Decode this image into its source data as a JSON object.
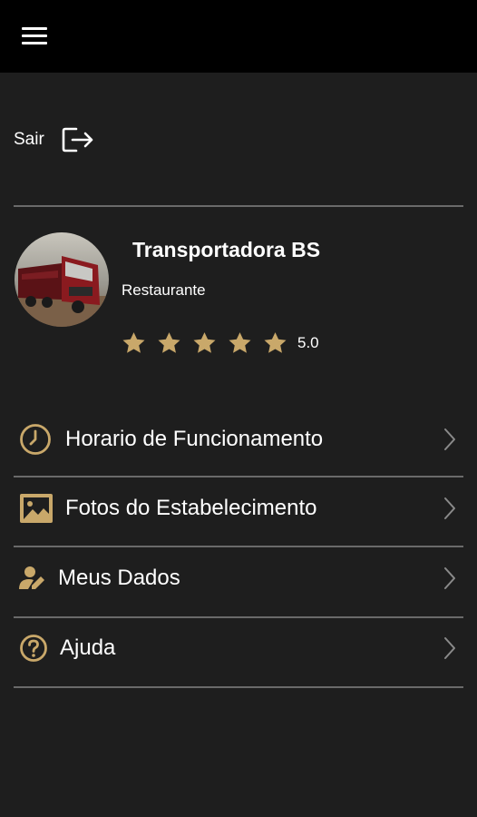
{
  "header": {
    "menu_icon": "hamburger-menu-icon"
  },
  "logout": {
    "label": "Sair",
    "icon": "logout-icon"
  },
  "profile": {
    "name": "Transportadora BS",
    "type": "Restaurante",
    "rating": 5.0,
    "rating_label": "5.0",
    "stars_total": 5,
    "star_color": "#c9a86a"
  },
  "menu": [
    {
      "label": "Horario de Funcionamento",
      "icon": "clock-icon"
    },
    {
      "label": "Fotos do Estabelecimento",
      "icon": "image-icon"
    },
    {
      "label": "Meus Dados",
      "icon": "user-edit-icon"
    },
    {
      "label": "Ajuda",
      "icon": "help-icon"
    }
  ],
  "colors": {
    "accent": "#c9a86a",
    "background": "#1e1e1e",
    "topbar": "#000000",
    "divider": "#6a6a6a"
  }
}
